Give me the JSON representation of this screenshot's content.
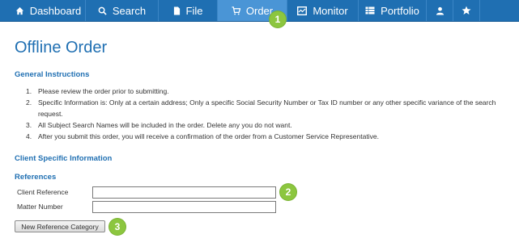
{
  "nav": {
    "dashboard": {
      "label": "Dashboard",
      "icon": "home-icon"
    },
    "search": {
      "label": "Search",
      "icon": "search-icon"
    },
    "file": {
      "label": "File",
      "icon": "file-icon"
    },
    "order": {
      "label": "Order",
      "icon": "cart-icon"
    },
    "monitor": {
      "label": "Monitor",
      "icon": "monitor-icon"
    },
    "portfolio": {
      "label": "Portfolio",
      "icon": "table-icon"
    },
    "user": {
      "icon": "user-icon"
    },
    "favorites": {
      "icon": "star-icon"
    }
  },
  "callouts": {
    "one": "1",
    "two": "2",
    "three": "3"
  },
  "page": {
    "title": "Offline Order"
  },
  "general": {
    "heading": "General Instructions",
    "items": [
      {
        "num": "1.",
        "text": "Please review the order prior to submitting."
      },
      {
        "num": "2.",
        "text": "Specific Information is: Only at a certain address; Only a specific Social Security Number or Tax ID number or any other specific variance of the search request."
      },
      {
        "num": "3.",
        "text": "All Subject Search Names will be included in the order. Delete any you do not want."
      },
      {
        "num": "4.",
        "text": "After you submit this order, you will receive a confirmation of the order from a Customer Service Representative."
      }
    ]
  },
  "client_specific": {
    "heading": "Client Specific Information"
  },
  "references": {
    "heading": "References",
    "client_reference": {
      "label": "Client Reference",
      "value": ""
    },
    "matter_number": {
      "label": "Matter Number",
      "value": ""
    },
    "new_category_label": "New Reference Category"
  },
  "colors": {
    "nav_background": "#1f6fb2",
    "nav_active": "#4a95d6",
    "heading_blue": "#1f6fb2",
    "callout_green": "#8cc63f"
  }
}
